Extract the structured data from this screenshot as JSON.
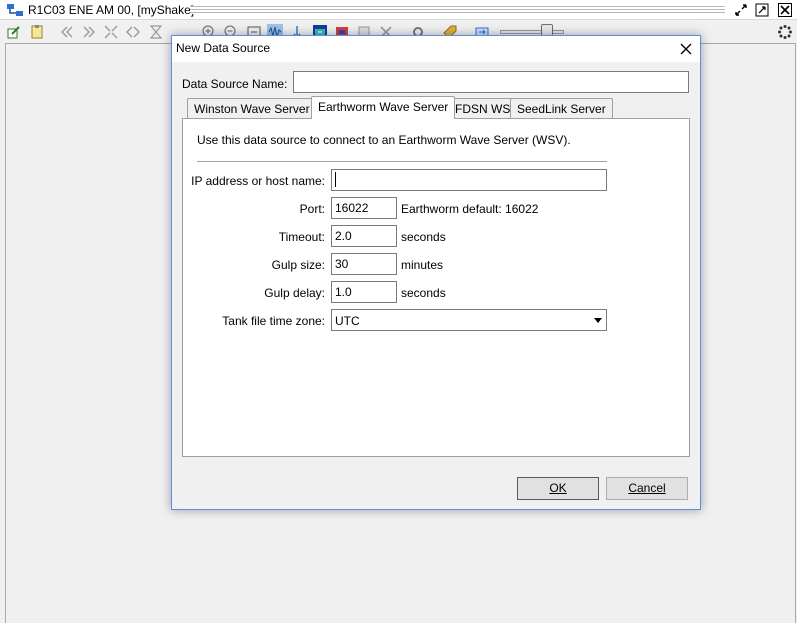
{
  "window": {
    "title": "R1C03 ENE AM 00, [myShake]"
  },
  "toolbar": {
    "icons": [
      "edit-icon",
      "clipboard-icon",
      "rewind-icon",
      "forward-icon",
      "compress-icon",
      "expand-icon",
      "filter-icon",
      "zoom-in-icon",
      "zoom-out-icon",
      "back-icon",
      "waveform-icon",
      "arrow-down-icon",
      "spectrogram-icon",
      "color-icon",
      "paste-icon",
      "delete-icon",
      "settings-icon",
      "tag-icon",
      "export-icon"
    ]
  },
  "dialog": {
    "title": "New Data Source",
    "data_source_name_label": "Data Source Name:",
    "data_source_name_value": "",
    "tabs": [
      {
        "label": "Winston Wave Server",
        "active": false
      },
      {
        "label": "Earthworm Wave Server",
        "active": true
      },
      {
        "label": "FDSN WS",
        "active": false
      },
      {
        "label": "SeedLink Server",
        "active": false
      }
    ],
    "panel": {
      "description": "Use this data source to connect to an Earthworm Wave Server (WSV).",
      "ip_label": "IP address or host name:",
      "ip_value": "",
      "port_label": "Port:",
      "port_value": "16022",
      "port_hint": "Earthworm default: 16022",
      "timeout_label": "Timeout:",
      "timeout_value": "2.0",
      "timeout_unit": "seconds",
      "gulp_size_label": "Gulp size:",
      "gulp_size_value": "30",
      "gulp_size_unit": "minutes",
      "gulp_delay_label": "Gulp delay:",
      "gulp_delay_value": "1.0",
      "gulp_delay_unit": "seconds",
      "timezone_label": "Tank file time zone:",
      "timezone_value": "UTC"
    },
    "ok_label": "OK",
    "cancel_label": "Cancel"
  },
  "colors": {
    "accent": "#5a8ee0",
    "background": "#f0f0f0"
  }
}
